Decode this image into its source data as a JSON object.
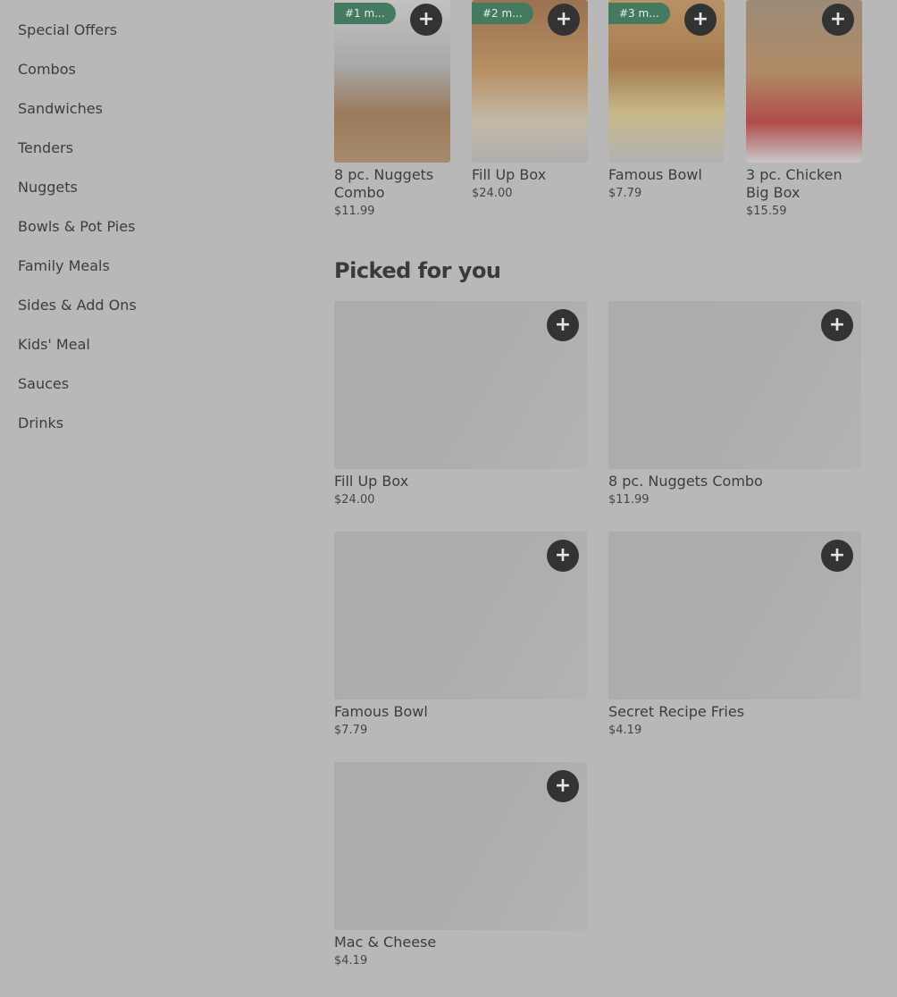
{
  "sidebar": {
    "items": [
      {
        "label": "Special Offers"
      },
      {
        "label": "Combos"
      },
      {
        "label": "Sandwiches"
      },
      {
        "label": "Tenders"
      },
      {
        "label": "Nuggets"
      },
      {
        "label": "Bowls & Pot Pies"
      },
      {
        "label": "Family Meals"
      },
      {
        "label": "Sides & Add Ons"
      },
      {
        "label": "Kids' Meal"
      },
      {
        "label": "Sauces"
      },
      {
        "label": "Drinks"
      }
    ]
  },
  "carousel": {
    "items": [
      {
        "badge": "#1 m...",
        "name": "8 pc. Nuggets Combo",
        "price": "$11.99"
      },
      {
        "badge": "#2 m...",
        "name": "Fill Up Box",
        "price": "$24.00"
      },
      {
        "badge": "#3 m...",
        "name": "Famous Bowl",
        "price": "$7.79"
      },
      {
        "badge": "",
        "name": "3 pc. Chicken Big Box",
        "price": "$15.59"
      }
    ],
    "add_label": "+"
  },
  "picked": {
    "title": "Picked for you",
    "items": [
      {
        "name": "Fill Up Box",
        "price": "$24.00"
      },
      {
        "name": "8 pc. Nuggets Combo",
        "price": "$11.99"
      },
      {
        "name": "Famous Bowl",
        "price": "$7.79"
      },
      {
        "name": "Secret Recipe Fries",
        "price": "$4.19"
      },
      {
        "name": "Mac & Cheese",
        "price": "$4.19"
      }
    ]
  },
  "colors": {
    "overlay_background": "#b8b8b8",
    "badge_green": "#437a60",
    "add_button": "#333333"
  }
}
